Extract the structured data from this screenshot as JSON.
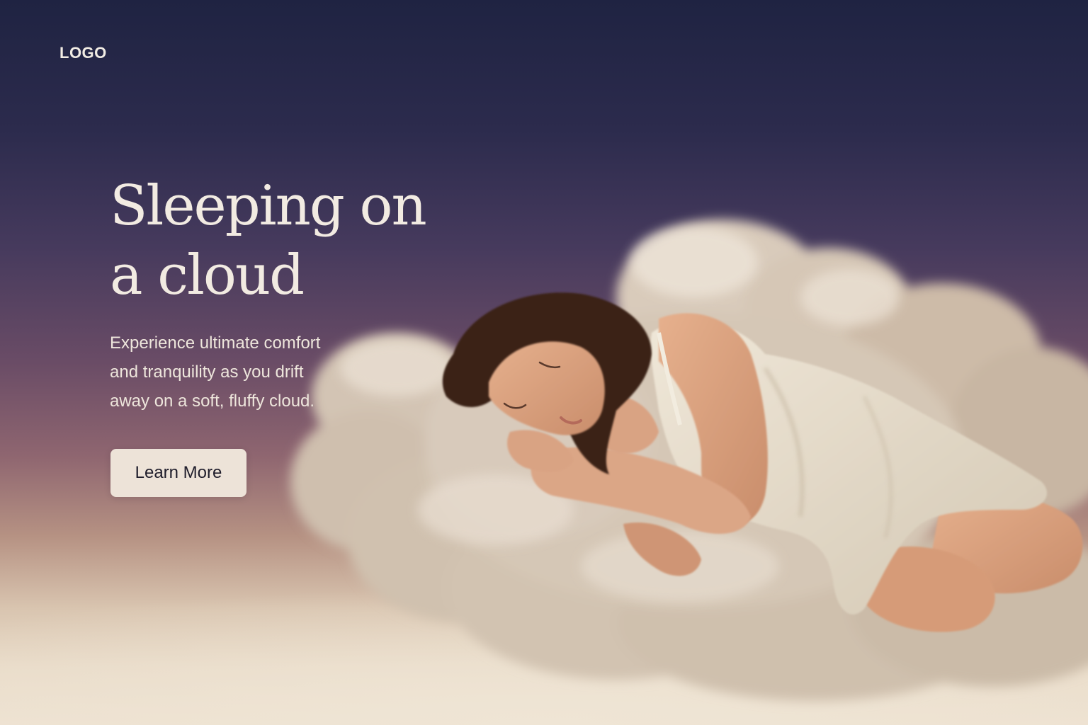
{
  "header": {
    "logo_text": "LOGO"
  },
  "hero": {
    "headline_line1": "Sleeping on",
    "headline_line2": "a cloud",
    "description_line1": "Experience ultimate comfort",
    "description_line2": "and tranquility as you drift",
    "description_line3": "away on a soft, fluffy cloud.",
    "cta_label": "Learn More"
  },
  "colors": {
    "sky_top": "#1f2342",
    "sky_mid": "#6a4c66",
    "sky_bottom": "#ede1d0",
    "headline": "#f2ebe2",
    "button_bg": "#ede3d8",
    "button_text": "#1f1d2b"
  }
}
